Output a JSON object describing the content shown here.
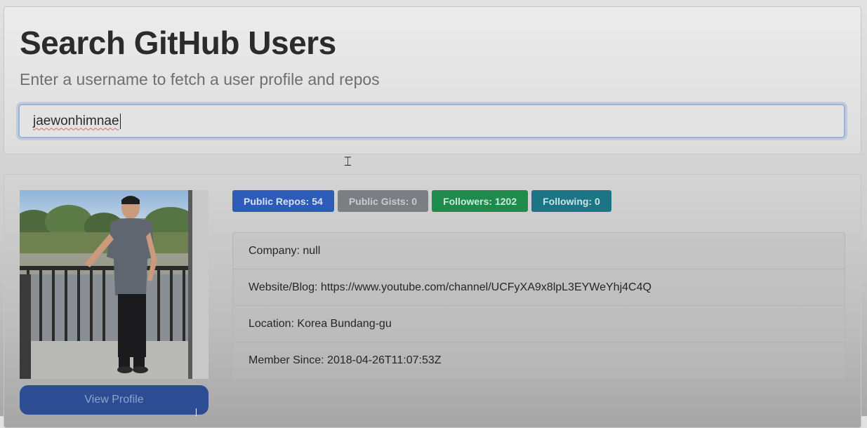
{
  "header": {
    "title": "Search GitHub Users",
    "subtitle": "Enter a username to fetch a user profile and repos"
  },
  "search": {
    "value": "jaewonhimnae",
    "placeholder": ""
  },
  "profile": {
    "avatar_icon": "user-photo",
    "view_profile_label": "View Profile",
    "badges": [
      {
        "label": "Public Repos: 54",
        "color": "#2d5bb8"
      },
      {
        "label": "Public Gists: 0",
        "color": "#7b7e82"
      },
      {
        "label": "Followers: 1202",
        "color": "#1e8a4c"
      },
      {
        "label": "Following: 0",
        "color": "#1c7584"
      }
    ],
    "details": [
      {
        "label": "Company:",
        "value": "null"
      },
      {
        "label": "Website/Blog:",
        "value": "https://www.youtube.com/channel/UCFyXA9x8lpL3EYWeYhj4C4Q"
      },
      {
        "label": "Location:",
        "value": "Korea Bundang-gu"
      },
      {
        "label": "Member Since:",
        "value": "2018-04-26T11:07:53Z"
      }
    ]
  },
  "colors": {
    "accent_primary": "#2d5bb8",
    "button_primary": "#2c4d94"
  }
}
